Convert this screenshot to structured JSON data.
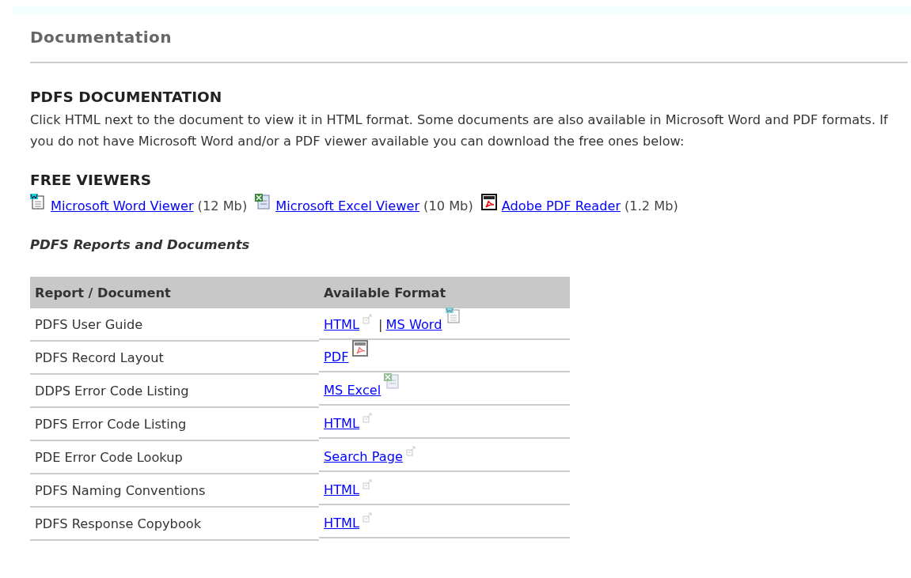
{
  "page_title": "Documentation",
  "intro": {
    "heading": "PDFS DOCUMENTATION",
    "text": "Click HTML next to the document to view it in HTML format. Some documents are also available in Microsoft Word and PDF formats. If you do not have Microsoft Word and/or a PDF viewer available you can download the free ones below:"
  },
  "viewers": {
    "heading": "FREE VIEWERS",
    "items": [
      {
        "kind": "word",
        "label": "Microsoft Word Viewer",
        "size": "(12 Mb)"
      },
      {
        "kind": "excel",
        "label": "Microsoft Excel Viewer",
        "size": "(10 Mb)"
      },
      {
        "kind": "pdf",
        "label": "Adobe PDF Reader",
        "size": "(1.2 Mb)"
      }
    ]
  },
  "reports": {
    "heading": "PDFS Reports and Documents",
    "columns": [
      "Report / Document",
      "Available Format"
    ],
    "rows": [
      {
        "name": "PDFS User Guide",
        "formats": [
          {
            "label": "HTML",
            "kind": "external"
          },
          {
            "label": "MS Word",
            "kind": "word"
          }
        ],
        "separator": "|"
      },
      {
        "name": "PDFS Record Layout",
        "formats": [
          {
            "label": "PDF",
            "kind": "pdf"
          }
        ]
      },
      {
        "name": "DDPS Error Code Listing",
        "formats": [
          {
            "label": "MS Excel",
            "kind": "excel"
          }
        ]
      },
      {
        "name": "PDFS Error Code Listing",
        "formats": [
          {
            "label": "HTML",
            "kind": "external"
          }
        ]
      },
      {
        "name": "PDE Error Code Lookup",
        "formats": [
          {
            "label": "Search Page",
            "kind": "external"
          }
        ]
      },
      {
        "name": "PDFS Naming Conventions",
        "formats": [
          {
            "label": "HTML",
            "kind": "external"
          }
        ]
      },
      {
        "name": "PDFS Response Copybook",
        "formats": [
          {
            "label": "HTML",
            "kind": "external"
          }
        ]
      }
    ]
  }
}
